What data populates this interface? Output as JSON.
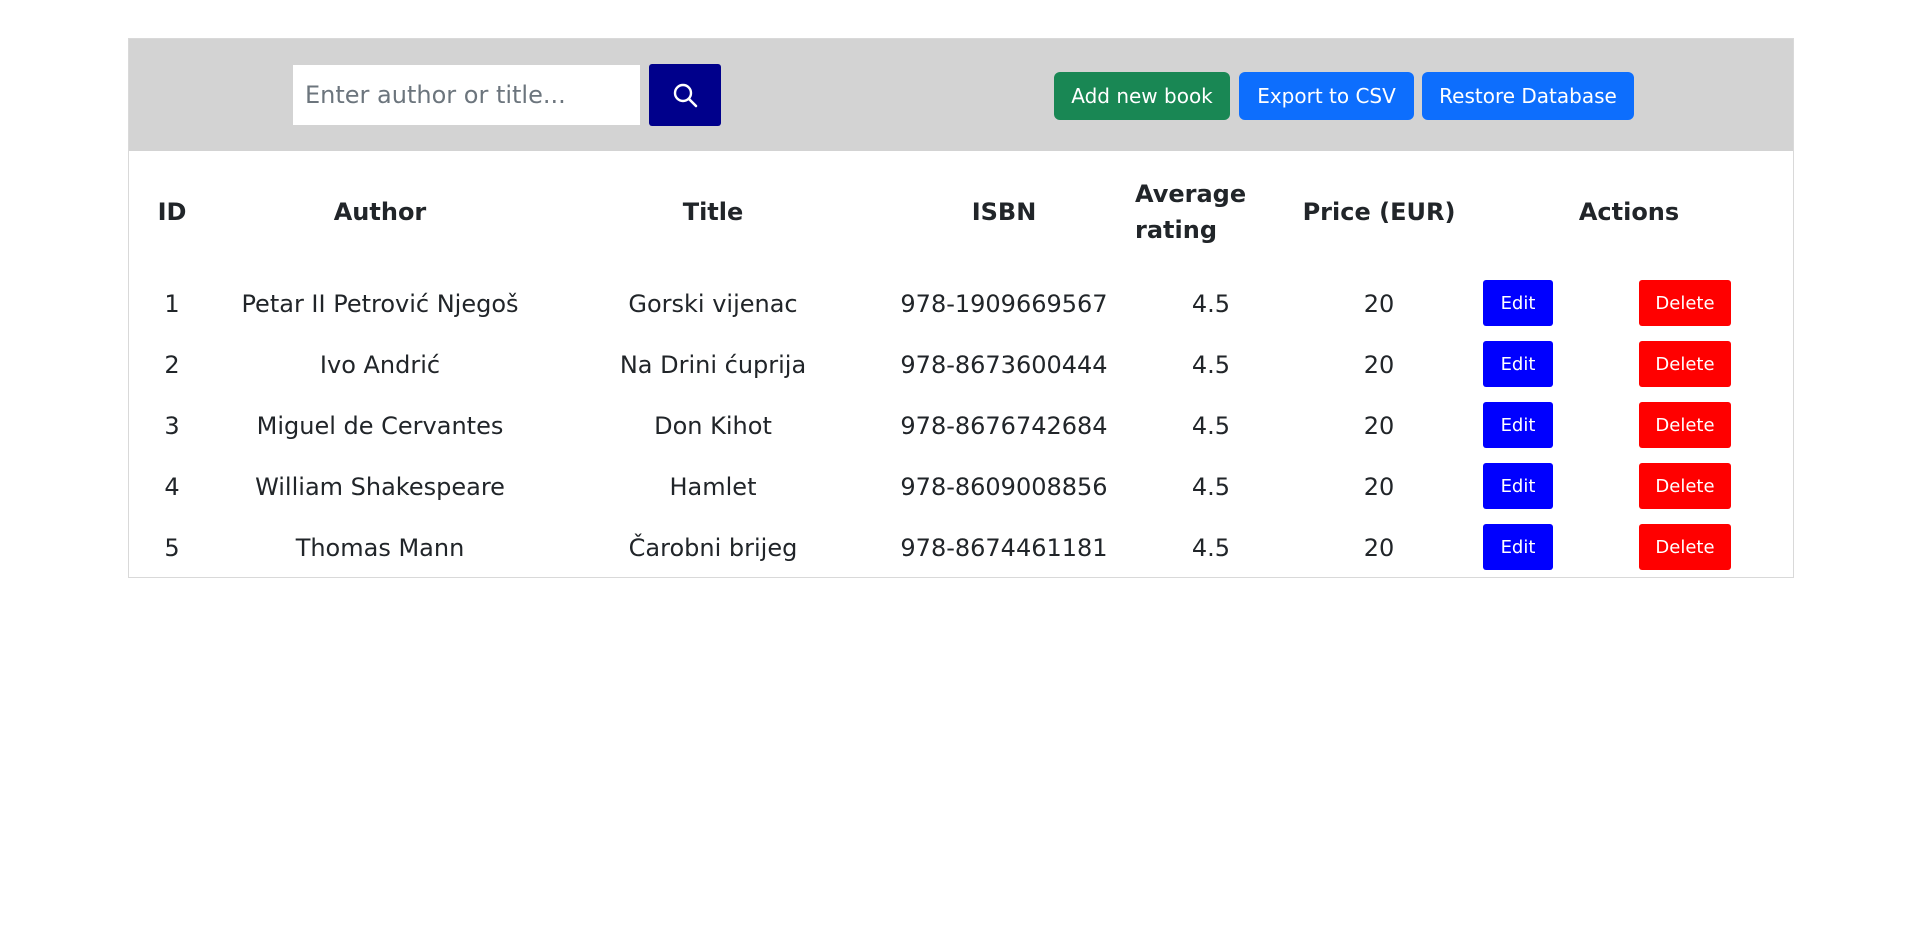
{
  "toolbar": {
    "search_placeholder": "Enter author or title...",
    "search_icon": "magnifier-icon",
    "add_label": "Add new book",
    "export_label": "Export to CSV",
    "restore_label": "Restore Database"
  },
  "table": {
    "headers": {
      "id": "ID",
      "author": "Author",
      "title": "Title",
      "isbn": "ISBN",
      "rating": "Average rating",
      "price": "Price (EUR)",
      "actions": "Actions"
    },
    "edit_label": "Edit",
    "delete_label": "Delete",
    "rows": [
      {
        "id": "1",
        "author": "Petar II Petrović Njegoš",
        "title": "Gorski vijenac",
        "isbn": "978-1909669567",
        "rating": "4.5",
        "price": "20"
      },
      {
        "id": "2",
        "author": "Ivo Andrić",
        "title": "Na Drini ćuprija",
        "isbn": "978-8673600444",
        "rating": "4.5",
        "price": "20"
      },
      {
        "id": "3",
        "author": "Miguel de Cervantes",
        "title": "Don Kihot",
        "isbn": "978-8676742684",
        "rating": "4.5",
        "price": "20"
      },
      {
        "id": "4",
        "author": "William Shakespeare",
        "title": "Hamlet",
        "isbn": "978-8609008856",
        "rating": "4.5",
        "price": "20"
      },
      {
        "id": "5",
        "author": "Thomas Mann",
        "title": "Čarobni brijeg",
        "isbn": "978-8674461181",
        "rating": "4.5",
        "price": "20"
      }
    ]
  },
  "colors": {
    "toolbar_bg": "#d3d3d3",
    "search_button": "#00008b",
    "add_button": "#198754",
    "export_button": "#0d6efd",
    "restore_button": "#0d6efd",
    "edit_button": "#0000ff",
    "delete_button": "#ff0000"
  }
}
